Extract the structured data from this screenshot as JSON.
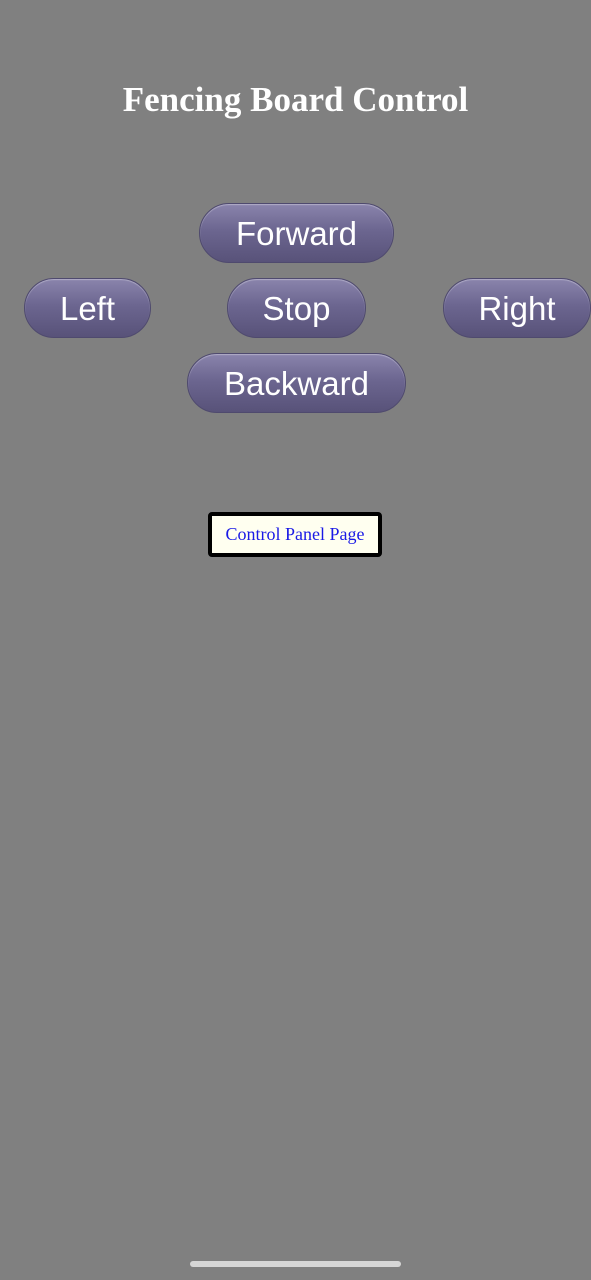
{
  "page": {
    "title": "Fencing Board Control",
    "background_color": "#808080"
  },
  "controls": {
    "forward": "Forward",
    "left": "Left",
    "stop": "Stop",
    "right": "Right",
    "backward": "Backward",
    "button_color": "#6c6690"
  },
  "link": {
    "control_panel": "Control Panel Page",
    "text_color": "#1a1ae6"
  }
}
